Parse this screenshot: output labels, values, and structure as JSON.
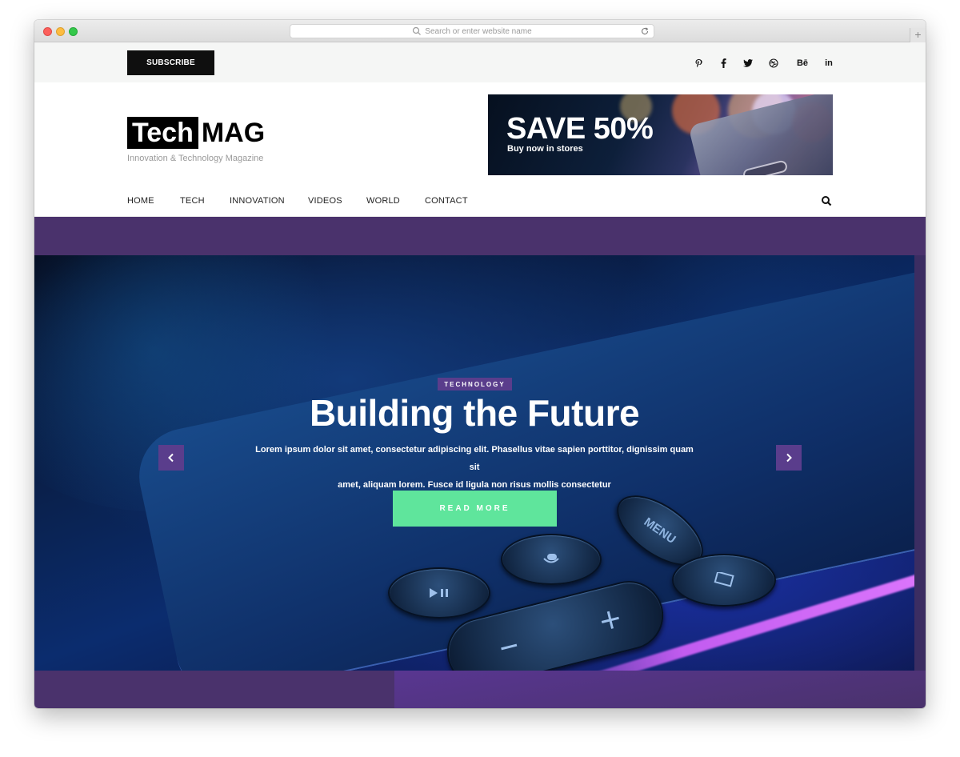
{
  "browser": {
    "url_placeholder": "Search or enter website name",
    "new_tab_label": "+"
  },
  "topbar": {
    "subscribe_label": "SUBSCRIBE",
    "social_icons": [
      "pinterest-icon",
      "facebook-icon",
      "twitter-icon",
      "dribbble-icon",
      "behance-icon",
      "linkedin-icon"
    ],
    "behance_label": "Bē",
    "linkedin_label": "in"
  },
  "header": {
    "logo_part1": "Tech",
    "logo_part2": "MAG",
    "tagline": "Innovation & Technology Magazine"
  },
  "ad": {
    "headline": "SAVE 50%",
    "subline": "Buy now in stores"
  },
  "nav": {
    "items": [
      {
        "label": "HOME"
      },
      {
        "label": "TECH"
      },
      {
        "label": "INNOVATION"
      },
      {
        "label": "VIDEOS"
      },
      {
        "label": "WORLD"
      },
      {
        "label": "CONTACT"
      }
    ]
  },
  "hero": {
    "category": "TECHNOLOGY",
    "title": "Building the Future",
    "description_line1": "Lorem ipsum dolor sit amet, consectetur adipiscing elit. Phasellus vitae sapien porttitor, dignissim quam sit",
    "description_line2": "amet, aliquam lorem. Fusce id ligula non risus mollis consectetur",
    "button_label": "READ MORE",
    "remote_menu_label": "MENU"
  },
  "colors": {
    "accent_purple": "#5a3d8c",
    "band_purple": "#4a326c",
    "button_green": "#5fe59c",
    "subscribe_black": "#0f0f0f"
  }
}
